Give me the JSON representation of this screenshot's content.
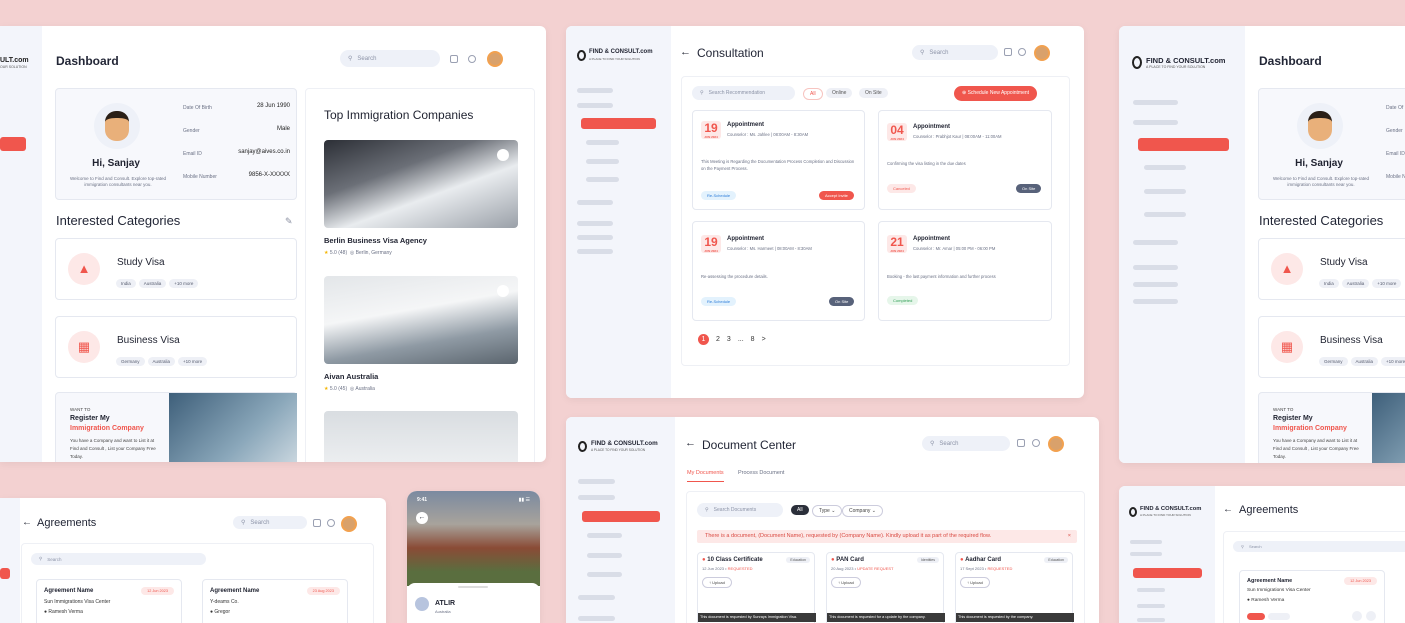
{
  "brand": {
    "name": "FIND & CONSULT.com",
    "tagline": "A PLACE TO FIND YOUR SOLUTION",
    "left_clip": "ULT.com",
    "left_clip_tag": "OUR SOLUTION"
  },
  "colors": {
    "accent": "#f0564d",
    "background": "#f3d1d1"
  },
  "search_placeholder": "Search",
  "dashboard": {
    "title": "Dashboard",
    "greeting": "Hi, Sanjay",
    "subtitle": "Welcome to Find and Consult. Explore top-rated immigration consultants near you.",
    "profile_rows": [
      {
        "label": "Date Of Birth",
        "value": "28 Jun 1990"
      },
      {
        "label": "Gender",
        "value": "Male"
      },
      {
        "label": "Email ID",
        "value": "sanjay@aives.co.in"
      },
      {
        "label": "Mobile Number",
        "value": "9856-X-XXXXX"
      }
    ],
    "categories_title": "Interested Categories",
    "categories": [
      {
        "name": "Study Visa",
        "tags": [
          "India",
          "Australia",
          "+10 more"
        ]
      },
      {
        "name": "Business Visa",
        "tags": [
          "Germany",
          "Australia",
          "+10 more"
        ]
      }
    ],
    "register": {
      "kicker": "WANT TO",
      "line1": "Register My",
      "line2": "Immigration Company",
      "body": "You have a Company and want to List it at Find and Consult , List your Company Free Today."
    },
    "companies_title": "Top Immigration Companies",
    "companies": [
      {
        "name": "Berlin Business Visa Agency",
        "rating": "5.0",
        "reviews": "(48)",
        "location": "Berlin, Germany"
      },
      {
        "name": "Aivan Australia",
        "rating": "5.0",
        "reviews": "(45)",
        "location": "Australia"
      }
    ]
  },
  "consultation": {
    "title": "Consultation",
    "search_placeholder": "Search Recommendation",
    "filters": [
      "All",
      "Online",
      "On Site"
    ],
    "schedule_btn": "Schedule New Appointment",
    "appointments": [
      {
        "day": "19",
        "month": "JUN 2024",
        "title": "Appointment",
        "counselor": "Counselor : Ms. Jahlee | 08:00AM - 8:30AM",
        "desc": "This Meeting is Regarding the Documentation Process Completion and Discussion on the Payment Process.",
        "left": "Re-Schedule",
        "right": "Accept Invite"
      },
      {
        "day": "04",
        "month": "JUN 2024",
        "title": "Appointment",
        "counselor": "Counselor : Prabhjot Kaur | 08:00AM - 11:00AM",
        "desc": "Confirming the visa listing in the due dates",
        "left": "Canceled",
        "right": "On Site"
      },
      {
        "day": "19",
        "month": "JUN 2024",
        "title": "Appointment",
        "counselor": "Counselor : Ms. Harmeet | 08:00AM - 8:30AM",
        "desc": "Re-assessing the procedure details.",
        "left": "Re-Schedule",
        "right": "On Site"
      },
      {
        "day": "21",
        "month": "JUN 2024",
        "title": "Appointment",
        "counselor": "Counselor : Mr. Amar | 05:00 PM - 06:00 PM",
        "desc": "Booking - the last payment information and further process",
        "left": "Completed",
        "right": ""
      }
    ],
    "pages": [
      "1",
      "2",
      "3",
      "...",
      "8",
      ">"
    ]
  },
  "documents": {
    "title": "Document Center",
    "tabs": [
      "My Documents",
      "Process Document"
    ],
    "search_placeholder": "Search Documents",
    "filters": [
      "All",
      "Type",
      "Company"
    ],
    "alert": "There is a document, (Document Name), requested by (Company Name). Kindly upload it as part of the required flow.",
    "docs": [
      {
        "name": "10 Class Certificate",
        "tag": "Education",
        "date": "12 Jun 2023",
        "status": "REQUESTED",
        "upload": "Upload",
        "note": "This document is requested by Sunrays Immigration Visa."
      },
      {
        "name": "PAN Card",
        "tag": "Identities",
        "date": "20 Aug 2023",
        "status": "UPDATE REQUEST",
        "upload": "Upload",
        "note": "This document is requested for a update by the company."
      },
      {
        "name": "Aadhar Card",
        "tag": "Education",
        "date": "17 Sept 2023",
        "status": "REQUESTED",
        "upload": "Upload",
        "note": "This document is requested by the company."
      }
    ]
  },
  "agreements": {
    "title": "Agreements",
    "search_placeholder": "Search",
    "cards": [
      {
        "name": "Agreement Name",
        "date": "12 Jun 2023",
        "company": "Sun Immigrations Visa Center",
        "person": "Ramesh Verma"
      },
      {
        "name": "Agreement Name",
        "date": "23 Aug 2023",
        "company": "Y-deams Co.",
        "person": "Gregor"
      }
    ]
  },
  "mobile": {
    "time": "9:41",
    "name": "ATLIR",
    "sub": "Australia"
  }
}
